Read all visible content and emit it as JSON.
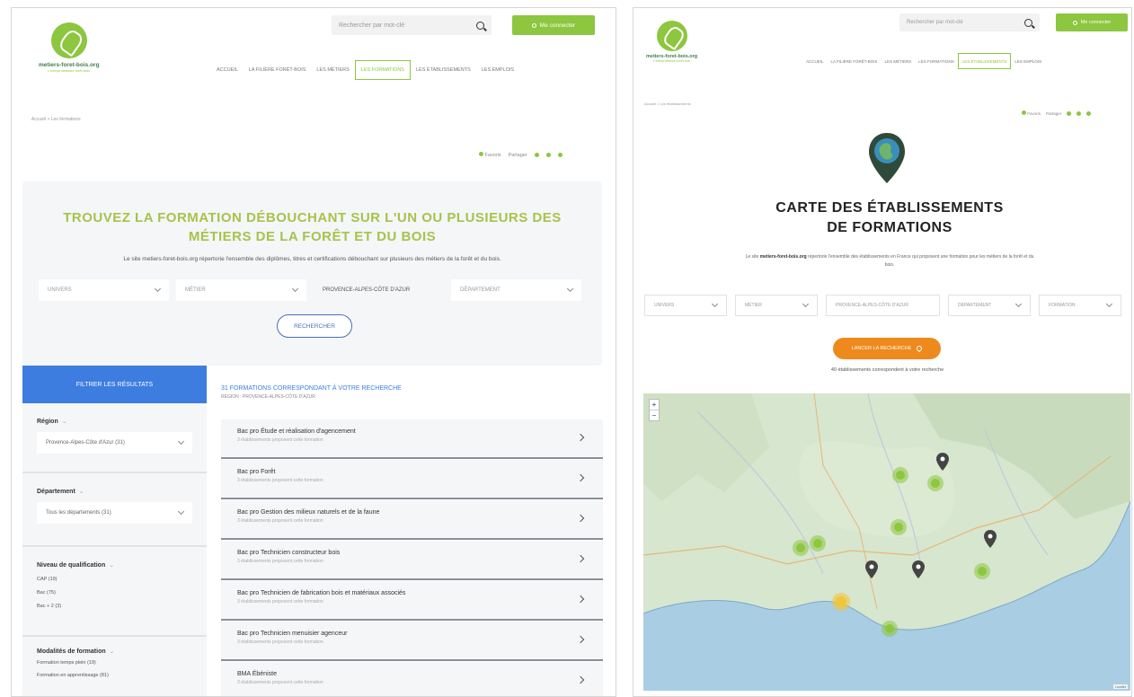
{
  "left": {
    "header": {
      "logo_title": "metiers-foret-bois.org",
      "logo_subtitle": "L'interprofession forêt-bois",
      "search_placeholder": "Rechercher par mot-clé",
      "connect_label": "Me connecter",
      "nav": [
        "Accueil",
        "La filière forêt-bois",
        "Les métiers",
        "Les formations",
        "Les établissements",
        "Les emplois"
      ],
      "nav_active": 3
    },
    "breadcrumb": "Accueil > Les formations",
    "share": {
      "favorite": "Favoris",
      "share": "Partager"
    },
    "hero": {
      "title": "TROUVEZ LA FORMATION DÉBOUCHANT SUR L'UN OU PLUSIEURS DES MÉTIERS DE LA FORÊT ET DU BOIS",
      "description": "Le site metiers-foret-bois.org répertorie l'ensemble des diplômes, titres et certifications débouchant sur plusieurs des métiers de la forêt et du bois.",
      "filters": [
        "Univers",
        "Métier",
        "PROVENCE-ALPES-CÔTE D'AZUR",
        "Département"
      ],
      "search_button": "Rechercher"
    },
    "sidebar": {
      "heading": "Filtrer les résultats",
      "region_label": "Région",
      "region_value": "Provence-Alpes-Côte d'Azur (31)",
      "dept_label": "Département",
      "dept_value": "Tous les départements (31)",
      "level_label": "Niveau de qualification",
      "levels": [
        "CAP (19)",
        "Bac (75)",
        "Bac + 2 (3)"
      ],
      "mode_label": "Modalités de formation",
      "modes": [
        "Formation temps plein (19)",
        "Formation en apprentissage (81)"
      ]
    },
    "results": {
      "title": "31 FORMATIONS CORRESPONDANT À VOTRE RECHERCHE",
      "subtitle": "Région : Provence-Alpes-Côte d'Azur",
      "items": [
        {
          "title": "Bac pro Étude et réalisation d'agencement",
          "meta": "3 établissements proposent cette formation"
        },
        {
          "title": "Bac pro Forêt",
          "meta": "3 établissements proposent cette formation"
        },
        {
          "title": "Bac pro Gestion des milieux naturels et de la faune",
          "meta": "3 établissements proposent cette formation"
        },
        {
          "title": "Bac pro Technicien constructeur bois",
          "meta": "3 établissements proposent cette formation"
        },
        {
          "title": "Bac pro Technicien de fabrication bois et matériaux associés",
          "meta": "3 établissements proposent cette formation"
        },
        {
          "title": "Bac pro Technicien menuisier agenceur",
          "meta": "3 établissements proposent cette formation"
        },
        {
          "title": "BMA Ébéniste",
          "meta": "3 établissements proposent cette formation"
        }
      ]
    }
  },
  "right": {
    "header": {
      "logo_title": "metiers-foret-bois.org",
      "logo_subtitle": "L'interprofession forêt-bois",
      "search_placeholder": "Rechercher par mot-clé",
      "connect_label": "Me connecter",
      "nav": [
        "Accueil",
        "La filière forêt-bois",
        "Les métiers",
        "Les formations",
        "Les établissements",
        "Les emplois"
      ],
      "nav_active": 4
    },
    "breadcrumb": "Accueil > Les établissements",
    "share": {
      "favorite": "Favoris",
      "share": "Partager"
    },
    "title_line1": "CARTE DES ÉTABLISSEMENTS",
    "title_line2": "DE FORMATIONS",
    "description_bold": "metiers-foret-bois.org",
    "description_pre": "Le site ",
    "description_post": " répertorie l'ensemble des établissements en France qui proposent une formation pour les métiers de la forêt et du bois.",
    "filters": [
      "Univers",
      "Métier",
      "PROVENCE-ALPES-CÔTE D'AZUR",
      "Département",
      "Formation"
    ],
    "search_button": "Lancer la recherche",
    "count_text": "40 établissements correspondent à votre recherche",
    "map": {
      "zoom_in": "+",
      "zoom_out": "−",
      "attribution": "Leaflet"
    }
  },
  "colors": {
    "brand_green": "#8dc63f",
    "title_green": "#a7c34a",
    "accent_blue": "#3d7de0",
    "accent_orange": "#ee8a1d",
    "sea": "#a9cde3",
    "land": "#d7e6cf"
  },
  "icons": [
    "search-icon",
    "user-icon",
    "chevron-down-icon",
    "chevron-right-icon",
    "map-pin-icon",
    "map-marker-icon",
    "twitter-icon",
    "facebook-icon"
  ]
}
